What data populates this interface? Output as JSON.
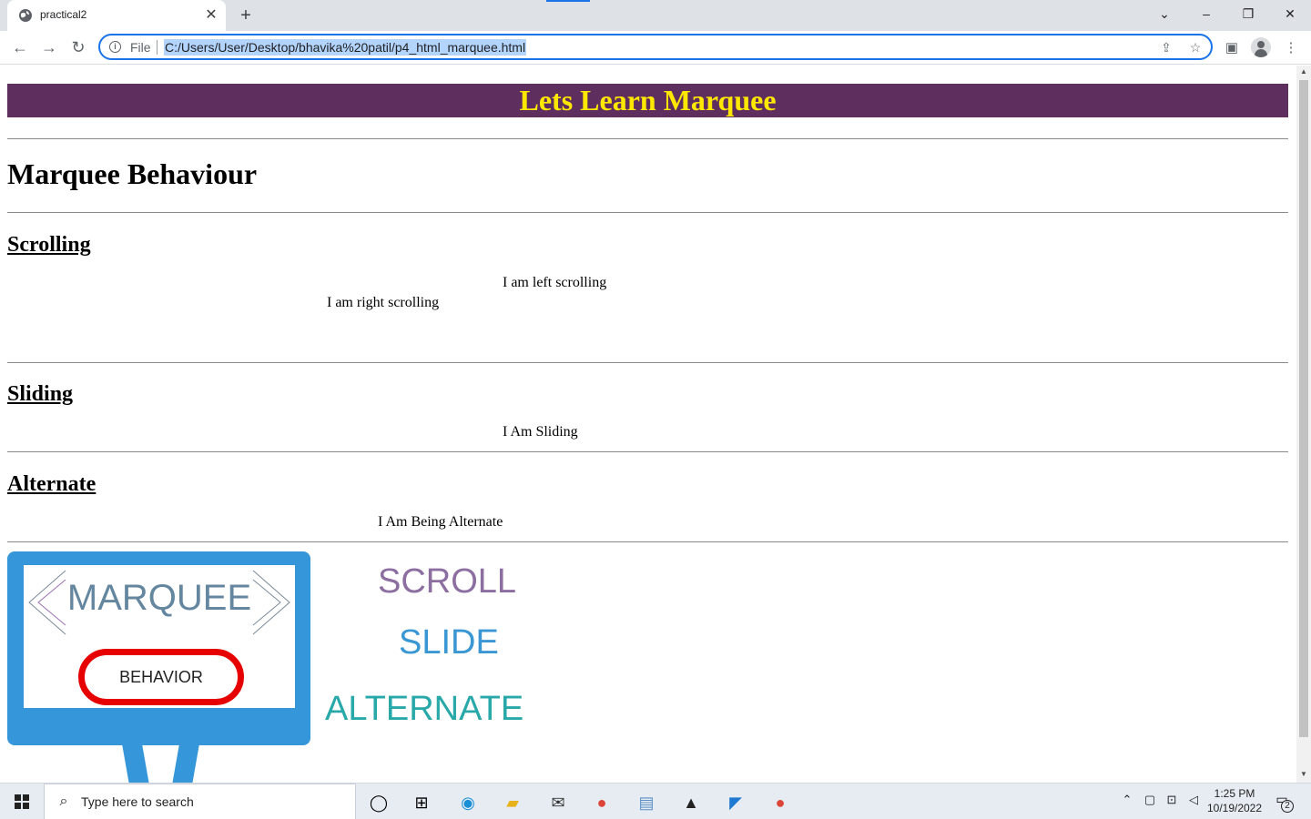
{
  "browser": {
    "tab_title": "practical2",
    "address_scheme_label": "File",
    "url": "C:/Users/User/Desktop/bhavika%20patil/p4_html_marquee.html"
  },
  "page": {
    "banner": "Lets Learn Marquee",
    "heading": "Marquee Behaviour",
    "sections": {
      "scrolling": {
        "heading": "Scrolling",
        "left_text": "I am left scrolling",
        "right_text": "I am right scrolling"
      },
      "sliding": {
        "heading": "Sliding",
        "text": "I Am Sliding"
      },
      "alternate": {
        "heading": "Alternate",
        "text": "I Am Being Alternate"
      }
    },
    "graphic": {
      "marquee_word": "MARQUEE",
      "behavior_word": "BEHAVIOR",
      "scroll_word": "SCROLL",
      "slide_word": "SLIDE",
      "alternate_word": "ALTERNATE"
    }
  },
  "taskbar": {
    "search_placeholder": "Type here to search",
    "time": "1:25 PM",
    "date": "10/19/2022",
    "notification_count": "2"
  },
  "colors": {
    "banner_bg": "#5e2e5e",
    "banner_text": "#ffe800",
    "monitor": "#3597d9",
    "scroll_word": "#8c6fa0",
    "slide_word": "#3a97d4",
    "alternate_word": "#28a8a8",
    "behavior_outline": "#e60000"
  }
}
